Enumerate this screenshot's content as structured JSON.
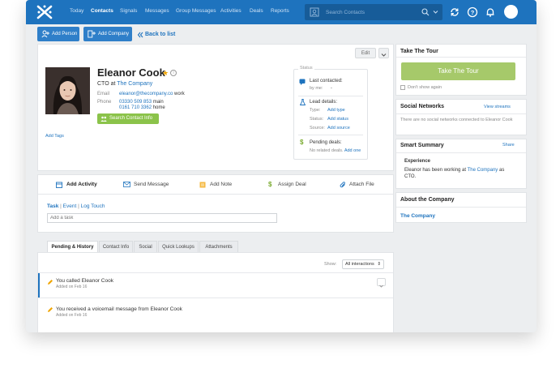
{
  "nav": {
    "items": [
      "Today",
      "Contacts",
      "Signals",
      "Messages",
      "Group Messages",
      "Activities",
      "Deals",
      "Reports"
    ],
    "search_placeholder": "Search Contacts"
  },
  "toolbar": {
    "add_person": "Add Person",
    "add_company": "Add Company",
    "back": "Back to list"
  },
  "contact": {
    "edit": "Edit",
    "name": "Eleanor Cook",
    "title_prefix": "CTO at",
    "company": "The Company",
    "email_label": "Email",
    "email": "eleanor@thecompany.co",
    "email_type": "work",
    "phone_label": "Phone",
    "phone_main": "03330 509 853",
    "phone_main_type": "main",
    "phone_home": "0161 710 3362",
    "phone_home_type": "home",
    "search_btn": "Search Contact Info",
    "add_tags": "Add Tags"
  },
  "status": {
    "title": "Status",
    "last_contacted": "Last contacted:",
    "by_me": "by me:",
    "by_me_value": "-",
    "lead_details": "Lead details:",
    "type_label": "Type:",
    "type_value": "Add type",
    "status_label": "Status:",
    "status_value": "Add status",
    "source_label": "Source:",
    "source_value": "Add source",
    "pending_deals": "Pending deals:",
    "no_deals": "No related deals.",
    "add_one": "Add one"
  },
  "actions": {
    "add_activity": "Add Activity",
    "send_message": "Send Message",
    "add_note": "Add Note",
    "assign_deal": "Assign Deal",
    "attach_file": "Attach File",
    "sub_task": "Task",
    "sub_event": "Event",
    "sub_log": "Log Touch",
    "task_placeholder": "Add a task"
  },
  "history_tabs": [
    "Pending & History",
    "Contact Info",
    "Social",
    "Quick Lookups",
    "Attachments"
  ],
  "history": {
    "show_label": "Show:",
    "show_value": "All interactions",
    "items": [
      {
        "text": "You called Eleanor Cook",
        "date": "Added on Feb 16"
      },
      {
        "text": "You received a voicemail message from Eleanor Cook",
        "date": "Added on Feb 16"
      }
    ]
  },
  "sidebar": {
    "tour_title": "Take The Tour",
    "tour_btn": "Take The Tour",
    "dont_show": "Don't show again",
    "social_title": "Social Networks",
    "view_streams": "View streams",
    "social_empty": "There are no social networks connected to Eleanor Cook",
    "smart_title": "Smart Summary",
    "share": "Share",
    "experience": "Experience",
    "exp_text_1": "Eleanor has been working at",
    "exp_company": "The Company",
    "exp_text_2": "as CTO.",
    "about_title": "About the Company",
    "about_company": "The Company"
  },
  "colors": {
    "nav_bg": "#1e73be",
    "green": "#8bc34a",
    "tour_green": "#a6c96a",
    "link": "#1e73be"
  }
}
